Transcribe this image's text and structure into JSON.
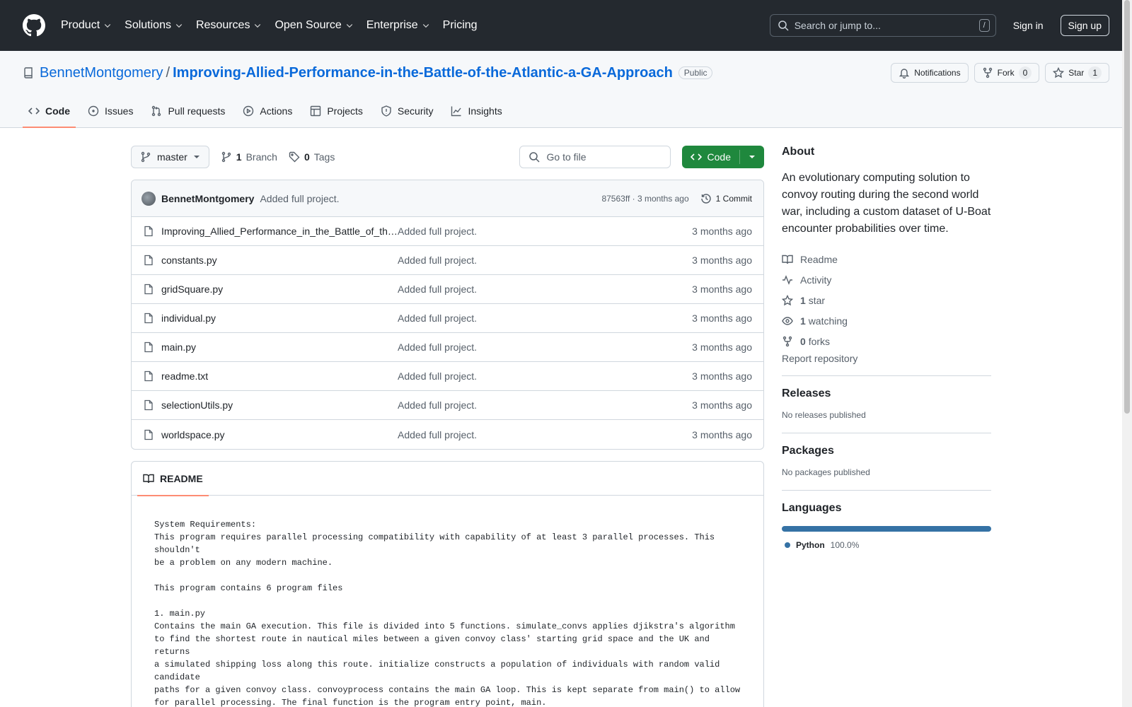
{
  "header": {
    "nav": [
      {
        "label": "Product"
      },
      {
        "label": "Solutions"
      },
      {
        "label": "Resources"
      },
      {
        "label": "Open Source"
      },
      {
        "label": "Enterprise"
      },
      {
        "label": "Pricing"
      }
    ],
    "search_placeholder": "Search or jump to...",
    "search_shortcut": "/",
    "sign_in": "Sign in",
    "sign_up": "Sign up"
  },
  "repo": {
    "owner": "BennetMontgomery",
    "separator": "/",
    "name": "Improving-Allied-Performance-in-the-Battle-of-the-Atlantic-a-GA-Approach",
    "visibility": "Public",
    "notifications_label": "Notifications",
    "fork_label": "Fork",
    "fork_count": "0",
    "star_label": "Star",
    "star_count": "1"
  },
  "tabs": [
    {
      "label": "Code",
      "icon": "code-icon"
    },
    {
      "label": "Issues",
      "icon": "issue-icon"
    },
    {
      "label": "Pull requests",
      "icon": "pull-request-icon"
    },
    {
      "label": "Actions",
      "icon": "play-icon"
    },
    {
      "label": "Projects",
      "icon": "table-icon"
    },
    {
      "label": "Security",
      "icon": "shield-icon"
    },
    {
      "label": "Insights",
      "icon": "graph-icon"
    }
  ],
  "toolbar": {
    "branch": "master",
    "branch_count": "1",
    "branch_label": "Branch",
    "tag_count": "0",
    "tag_label": "Tags",
    "goto_placeholder": "Go to file",
    "code_button": "Code"
  },
  "commit": {
    "author": "BennetMontgomery",
    "message": "Added full project.",
    "hash_time": "87563ff · 3 months ago",
    "count_label": "1 Commit"
  },
  "files": [
    {
      "name": "Improving_Allied_Performance_in_the_Battle_of_the_Atlantic_a_GA_Approach.pdf",
      "message": "Added full project.",
      "date": "3 months ago"
    },
    {
      "name": "constants.py",
      "message": "Added full project.",
      "date": "3 months ago"
    },
    {
      "name": "gridSquare.py",
      "message": "Added full project.",
      "date": "3 months ago"
    },
    {
      "name": "individual.py",
      "message": "Added full project.",
      "date": "3 months ago"
    },
    {
      "name": "main.py",
      "message": "Added full project.",
      "date": "3 months ago"
    },
    {
      "name": "readme.txt",
      "message": "Added full project.",
      "date": "3 months ago"
    },
    {
      "name": "selectionUtils.py",
      "message": "Added full project.",
      "date": "3 months ago"
    },
    {
      "name": "worldspace.py",
      "message": "Added full project.",
      "date": "3 months ago"
    }
  ],
  "readme": {
    "title": "README",
    "body": "System Requirements:\nThis program requires parallel processing compatibility with capability of at least 3 parallel processes. This\nshouldn't\nbe a problem on any modern machine.\n\nThis program contains 6 program files\n\n1. main.py\nContains the main GA execution. This file is divided into 5 functions. simulate_convs applies djikstra's algorithm\nto find the shortest route in nautical miles between a given convoy class' starting grid space and the UK and\nreturns\na simulated shipping loss along this route. initialize constructs a population of individuals with random valid\ncandidate\npaths for a given convoy class. convoyprocess contains the main GA loop. This is kept separate from main() to allow\nfor parallel processing. The final function is the program entry point, main."
  },
  "about": {
    "title": "About",
    "description": "An evolutionary computing solution to convoy routing during the second world war, including a custom dataset of U-Boat encounter probabilities over time.",
    "readme_label": "Readme",
    "activity_label": "Activity",
    "stars_count": "1",
    "stars_label": "star",
    "watching_count": "1",
    "watching_label": "watching",
    "forks_count": "0",
    "forks_label": "forks",
    "report_label": "Report repository"
  },
  "releases": {
    "title": "Releases",
    "empty": "No releases published"
  },
  "packages": {
    "title": "Packages",
    "empty": "No packages published"
  },
  "languages": {
    "title": "Languages",
    "items": [
      {
        "name": "Python",
        "percent": "100.0%",
        "color": "#3572a5"
      }
    ]
  },
  "colors": {
    "accent": "#0969da",
    "primary_button": "#1f883d",
    "tab_underline": "#fd8c73",
    "header_bg": "#24292f"
  }
}
